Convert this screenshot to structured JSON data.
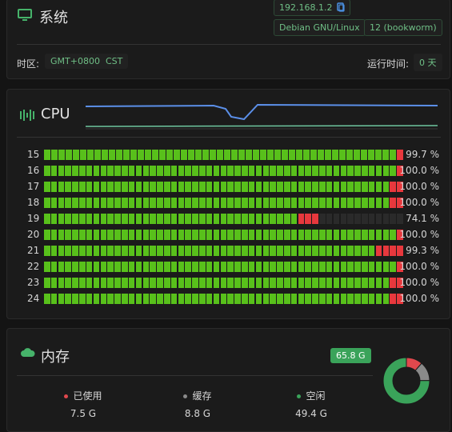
{
  "system": {
    "title": "系统",
    "ip": "192.168.1.2",
    "os": "Debian GNU/Linux",
    "version": "12 (bookworm)",
    "timezone_label": "时区:",
    "timezone_value": "GMT+0800  CST",
    "uptime_label": "运行时间:",
    "uptime_value": "0 天"
  },
  "cpu": {
    "title": "CPU",
    "cores": [
      {
        "id": "15",
        "pct": "99.7 %",
        "green": 49,
        "red": 1,
        "empty": 0
      },
      {
        "id": "16",
        "pct": "100.0 %",
        "green": 50,
        "red": 1,
        "empty": 0
      },
      {
        "id": "17",
        "pct": "100.0 %",
        "green": 49,
        "red": 2,
        "empty": 0
      },
      {
        "id": "18",
        "pct": "100.0 %",
        "green": 49,
        "red": 2,
        "empty": 0
      },
      {
        "id": "19",
        "pct": "74.1 %",
        "green": 36,
        "red": 3,
        "empty": 12
      },
      {
        "id": "20",
        "pct": "100.0 %",
        "green": 50,
        "red": 1,
        "empty": 0
      },
      {
        "id": "21",
        "pct": "99.3 %",
        "green": 47,
        "red": 4,
        "empty": 0
      },
      {
        "id": "22",
        "pct": "100.0 %",
        "green": 50,
        "red": 1,
        "empty": 0
      },
      {
        "id": "23",
        "pct": "100.0 %",
        "green": 49,
        "red": 2,
        "empty": 0
      },
      {
        "id": "24",
        "pct": "100.0 %",
        "green": 49,
        "red": 2,
        "empty": 0
      }
    ]
  },
  "memory": {
    "title": "内存",
    "total": "65.8 G",
    "used_label": "已使用",
    "used_value": "7.5 G",
    "cache_label": "缓存",
    "cache_value": "8.8 G",
    "free_label": "空闲",
    "free_value": "49.4 G",
    "used_fraction": 0.114,
    "cache_fraction": 0.134,
    "free_fraction": 0.752,
    "colors": {
      "used": "#e0484d",
      "cache": "#8a8a8a",
      "free": "#3aa35a"
    }
  }
}
